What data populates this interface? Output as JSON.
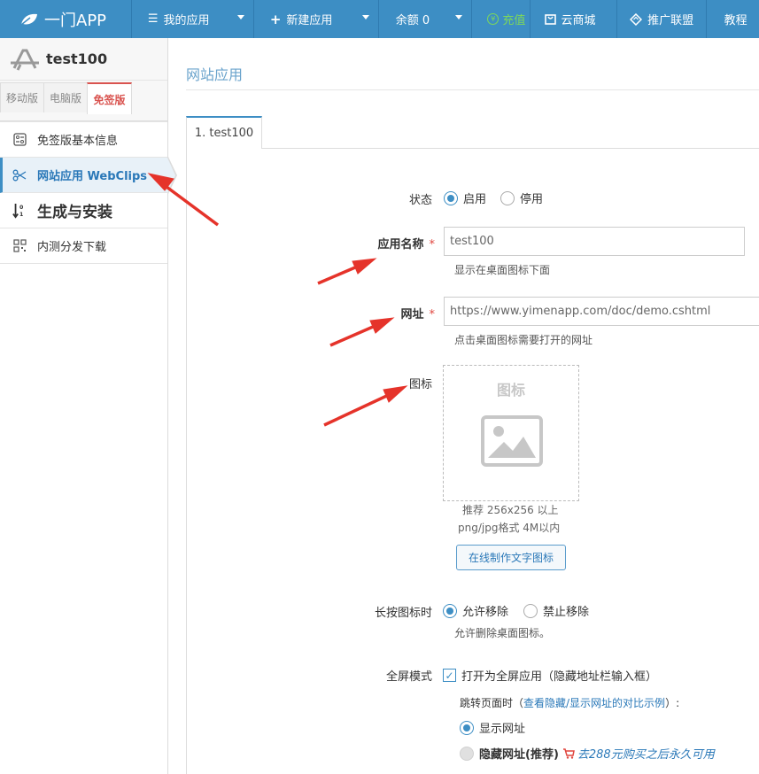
{
  "topnav": {
    "brand": "一门APP",
    "my_apps": "我的应用",
    "new_app": "新建应用",
    "balance": "余额 0",
    "recharge": "充值",
    "shop": "云商城",
    "affiliate": "推广联盟",
    "tutorial": "教程"
  },
  "sidebar": {
    "app_name": "test100",
    "tabs": [
      "移动版",
      "电脑版",
      "免签版"
    ],
    "items": [
      {
        "label": "免签版基本信息"
      },
      {
        "label": "网站应用 WebClips"
      },
      {
        "label": "生成与安装"
      },
      {
        "label": "内测分发下载"
      }
    ]
  },
  "main": {
    "section_title": "网站应用",
    "tab_label": "1. test100",
    "status": {
      "label": "状态",
      "opt_on": "启用",
      "opt_off": "停用"
    },
    "app_name": {
      "label": "应用名称",
      "req": "*",
      "value": "test100",
      "hint": "显示在桌面图标下面"
    },
    "url": {
      "label": "网址",
      "req": "*",
      "value": "https://www.yimenapp.com/doc/demo.cshtml",
      "hint": "点击桌面图标需要打开的网址"
    },
    "icon": {
      "label": "图标",
      "box_title": "图标",
      "hint1": "推荐 256x256 以上",
      "hint2": "png/jpg格式 4M以内",
      "button": "在线制作文字图标"
    },
    "longpress": {
      "label": "长按图标时",
      "opt_allow": "允许移除",
      "opt_forbid": "禁止移除",
      "hint": "允许删除桌面图标。"
    },
    "fullscreen": {
      "label": "全屏模式",
      "check_label": "打开为全屏应用（隐藏地址栏输入框）",
      "jump_prefix": "跳转页面时（",
      "jump_link": "查看隐藏/显示网址的对比示例",
      "jump_suffix": "）:",
      "opt_show": "显示网址",
      "opt_hide": "隐藏网址(推荐)",
      "price": "去288元购买之后永久可用"
    }
  },
  "colors": {
    "nav": "#3d8ec4",
    "accent_red": "#e0463f",
    "link": "#2a78b8"
  }
}
